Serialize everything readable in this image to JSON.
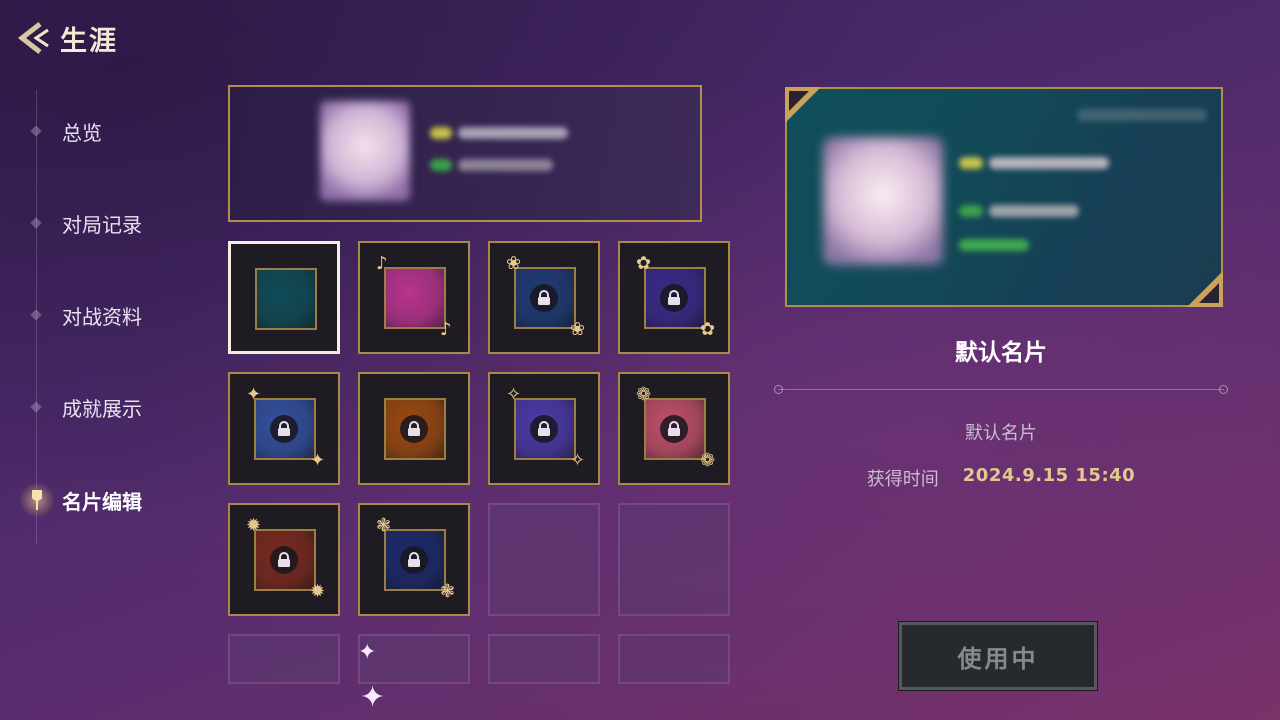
{
  "header": {
    "title": "生涯"
  },
  "sidebar": {
    "items": [
      {
        "label": "总览",
        "active": false
      },
      {
        "label": "对局记录",
        "active": false
      },
      {
        "label": "对战资料",
        "active": false
      },
      {
        "label": "成就展示",
        "active": false
      },
      {
        "label": "名片编辑",
        "active": true
      }
    ]
  },
  "cards": [
    {
      "color": "#0f4c58",
      "locked": false,
      "selected": true,
      "deco": ""
    },
    {
      "color": "#b8348f",
      "locked": false,
      "selected": false,
      "deco": "♪"
    },
    {
      "color": "#1f3b75",
      "locked": true,
      "selected": false,
      "deco": "❀"
    },
    {
      "color": "#3a2a8a",
      "locked": true,
      "selected": false,
      "deco": "✿"
    },
    {
      "color": "#3350a0",
      "locked": true,
      "selected": false,
      "deco": "✦"
    },
    {
      "color": "#9a4a10",
      "locked": true,
      "selected": false,
      "deco": ""
    },
    {
      "color": "#4a3aa8",
      "locked": true,
      "selected": false,
      "deco": "✧"
    },
    {
      "color": "#c0506a",
      "locked": true,
      "selected": false,
      "deco": "❁"
    },
    {
      "color": "#7a2a20",
      "locked": true,
      "selected": false,
      "deco": "✹"
    },
    {
      "color": "#1b2a6a",
      "locked": true,
      "selected": false,
      "deco": "❃"
    }
  ],
  "empty_slots": 6,
  "detail": {
    "name": "默认名片",
    "description": "默认名片",
    "time_label": "获得时间",
    "time_value": "2024.9.15  15:40",
    "button_label": "使用中"
  },
  "colors": {
    "gold": "#b08f4a",
    "accent_text": "#e3c98f"
  }
}
